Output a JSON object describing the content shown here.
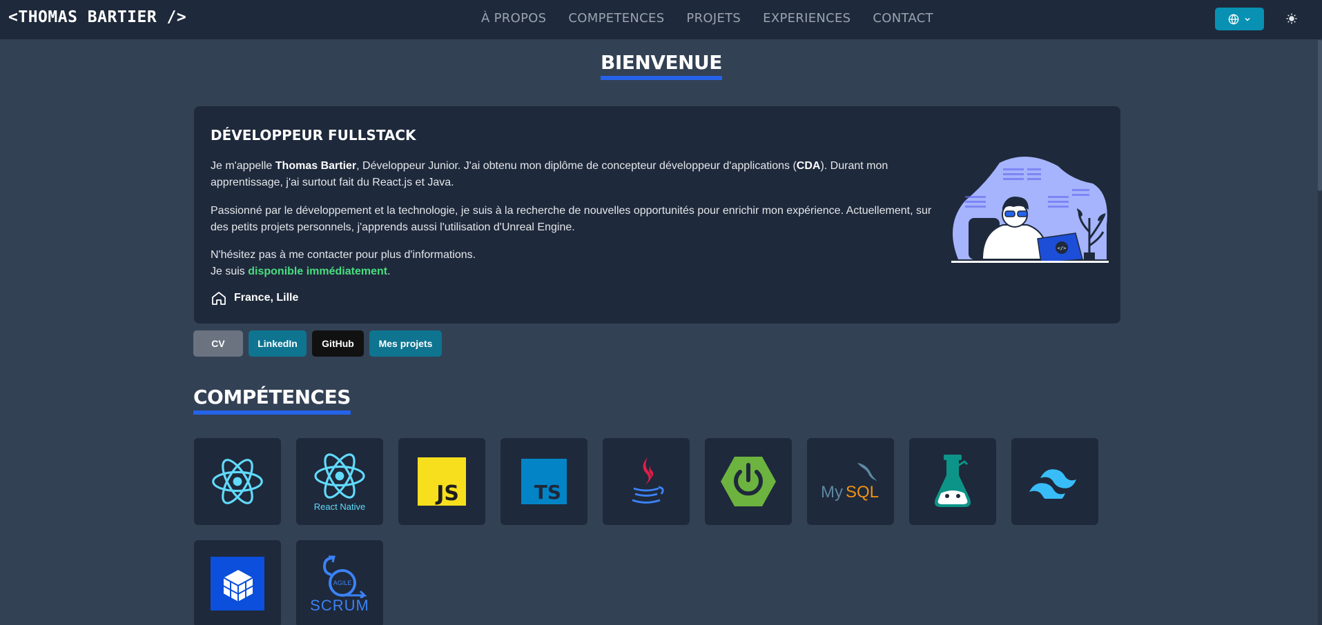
{
  "nav": {
    "brand": "<THOMAS BARTIER />",
    "links": [
      "À PROPOS",
      "COMPETENCES",
      "PROJETS",
      "EXPERIENCES",
      "CONTACT"
    ],
    "lang_icon": "globe-icon",
    "theme_icon": "sun-icon"
  },
  "about": {
    "heading": "BIENVENUE",
    "title": "DÉVELOPPEUR FULLSTACK",
    "p1_a": "Je m'appelle ",
    "p1_name": "Thomas Bartier",
    "p1_b": ", Développeur Junior. J'ai obtenu mon diplôme de concepteur développeur d'applications (",
    "p1_cda": "CDA",
    "p1_c": "). Durant mon apprentissage, j'ai surtout fait du React.js et Java.",
    "p2": "Passionné par le développement et la technologie, je suis à la recherche de nouvelles opportunités pour enrichir mon expérience. Actuellement, sur des petits projets personnels, j'apprends aussi l'utilisation d'Unreal Engine.",
    "p3": "N'hésitez pas à me contacter pour plus d'informations.",
    "p4_a": "Je suis ",
    "p4_available": "disponible immédiatement",
    "p4_b": ".",
    "location": "France, Lille"
  },
  "buttons": {
    "cv": "CV",
    "linkedin": "LinkedIn",
    "github": "GitHub",
    "projects": "Mes projets"
  },
  "skills": {
    "heading": "COMPÉTENCES",
    "items": [
      {
        "name": "react-icon"
      },
      {
        "name": "react-native-icon",
        "label": "React Native"
      },
      {
        "name": "javascript-icon",
        "label": "JS"
      },
      {
        "name": "typescript-icon",
        "label": "TS"
      },
      {
        "name": "java-icon"
      },
      {
        "name": "spring-boot-icon"
      },
      {
        "name": "mysql-icon",
        "label_a": "My",
        "label_b": "SQL"
      },
      {
        "name": "flask-icon"
      },
      {
        "name": "tailwind-icon"
      },
      {
        "name": "hibernate-icon"
      },
      {
        "name": "scrum-icon",
        "label": "SCRUM",
        "sub": "AGILE"
      }
    ]
  },
  "colors": {
    "background": "#334155",
    "navbar": "#1e293b",
    "card": "#1e293b",
    "accent": "#2563eb",
    "available": "#4ade80",
    "lang_button": "#0891b2"
  }
}
